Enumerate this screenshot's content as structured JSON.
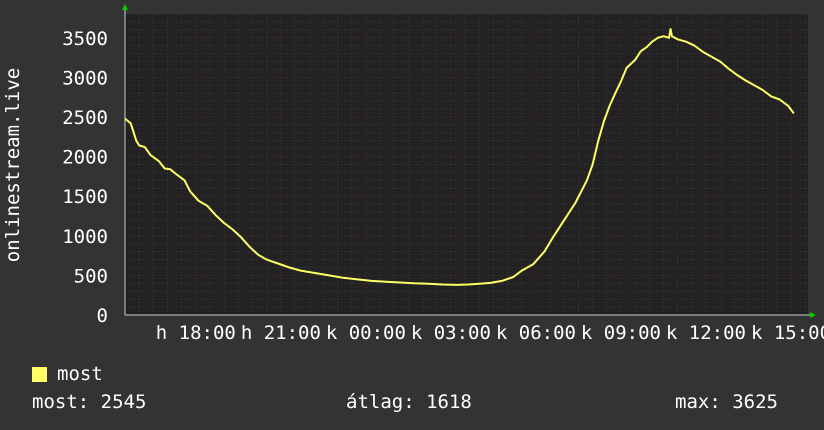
{
  "chart_data": {
    "type": "line",
    "ylabel": "onlinestream.live",
    "yticks": [
      0,
      500,
      1000,
      1500,
      2000,
      2500,
      3000,
      3500
    ],
    "ylim": [
      0,
      3800
    ],
    "xlim_hours": [
      15.5,
      39.6
    ],
    "xticks": [
      {
        "label": "h 18:00",
        "hour": 18
      },
      {
        "label": "h 21:00",
        "hour": 21
      },
      {
        "label": "k 00:00",
        "hour": 24
      },
      {
        "label": "k 03:00",
        "hour": 27
      },
      {
        "label": "k 06:00",
        "hour": 30
      },
      {
        "label": "k 09:00",
        "hour": 33
      },
      {
        "label": "k 12:00",
        "hour": 36
      },
      {
        "label": "k 15:00",
        "hour": 39
      }
    ],
    "grid": true,
    "series": [
      {
        "name": "most",
        "color": "#ffff66",
        "points": [
          [
            15.5,
            2480
          ],
          [
            15.7,
            2420
          ],
          [
            15.9,
            2200
          ],
          [
            16.0,
            2140
          ],
          [
            16.2,
            2120
          ],
          [
            16.4,
            2020
          ],
          [
            16.7,
            1940
          ],
          [
            16.9,
            1850
          ],
          [
            17.1,
            1840
          ],
          [
            17.3,
            1780
          ],
          [
            17.6,
            1700
          ],
          [
            17.8,
            1560
          ],
          [
            18.1,
            1440
          ],
          [
            18.4,
            1380
          ],
          [
            18.7,
            1260
          ],
          [
            19.0,
            1160
          ],
          [
            19.3,
            1080
          ],
          [
            19.6,
            980
          ],
          [
            19.9,
            860
          ],
          [
            20.2,
            760
          ],
          [
            20.5,
            700
          ],
          [
            20.9,
            650
          ],
          [
            21.3,
            600
          ],
          [
            21.7,
            560
          ],
          [
            22.2,
            530
          ],
          [
            22.7,
            500
          ],
          [
            23.2,
            470
          ],
          [
            23.7,
            450
          ],
          [
            24.2,
            430
          ],
          [
            24.7,
            420
          ],
          [
            25.2,
            410
          ],
          [
            25.7,
            400
          ],
          [
            26.2,
            395
          ],
          [
            26.7,
            385
          ],
          [
            27.2,
            380
          ],
          [
            27.6,
            385
          ],
          [
            28.0,
            395
          ],
          [
            28.4,
            405
          ],
          [
            28.8,
            430
          ],
          [
            29.2,
            480
          ],
          [
            29.5,
            560
          ],
          [
            29.9,
            640
          ],
          [
            30.3,
            800
          ],
          [
            30.6,
            980
          ],
          [
            31.0,
            1200
          ],
          [
            31.4,
            1420
          ],
          [
            31.8,
            1700
          ],
          [
            32.0,
            1900
          ],
          [
            32.2,
            2200
          ],
          [
            32.4,
            2450
          ],
          [
            32.6,
            2640
          ],
          [
            32.8,
            2800
          ],
          [
            33.0,
            2950
          ],
          [
            33.2,
            3120
          ],
          [
            33.5,
            3220
          ],
          [
            33.7,
            3330
          ],
          [
            33.9,
            3380
          ],
          [
            34.1,
            3450
          ],
          [
            34.3,
            3500
          ],
          [
            34.5,
            3520
          ],
          [
            34.7,
            3500
          ],
          [
            34.75,
            3610
          ],
          [
            34.8,
            3520
          ],
          [
            35.0,
            3480
          ],
          [
            35.3,
            3450
          ],
          [
            35.6,
            3400
          ],
          [
            35.9,
            3320
          ],
          [
            36.2,
            3260
          ],
          [
            36.5,
            3200
          ],
          [
            36.8,
            3110
          ],
          [
            37.1,
            3030
          ],
          [
            37.4,
            2960
          ],
          [
            37.7,
            2900
          ],
          [
            38.0,
            2840
          ],
          [
            38.3,
            2760
          ],
          [
            38.6,
            2720
          ],
          [
            38.9,
            2640
          ],
          [
            39.1,
            2545
          ]
        ]
      }
    ]
  },
  "legend": {
    "label": "most",
    "color": "#ffff66"
  },
  "stats": {
    "current": "most: 2545",
    "average": "átlag: 1618",
    "max": "max: 3625"
  },
  "colors": {
    "background": "#333333",
    "plot_bg": "#222222",
    "grid_minor": "#3a3a3a",
    "grid_major": "#5a2a2a",
    "axis": "#ffffff",
    "arrow": "#00cc00"
  }
}
